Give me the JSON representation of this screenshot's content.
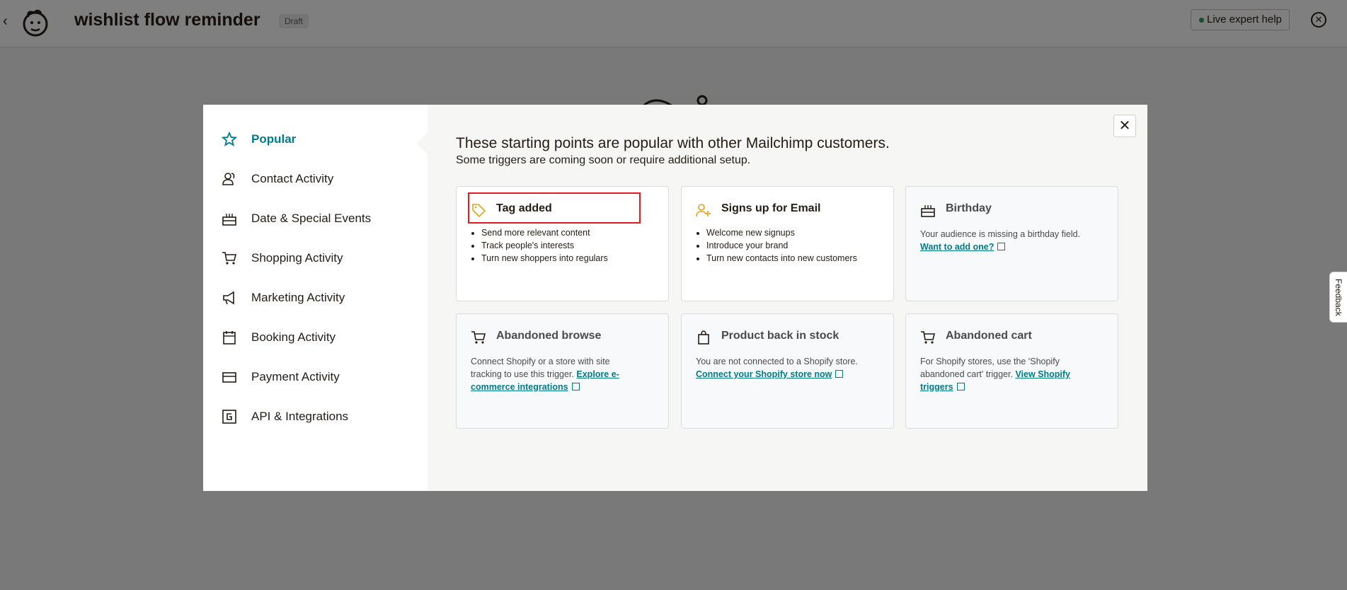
{
  "topbar": {
    "back": "‹",
    "title": "wishlist flow reminder",
    "status_badge": "Draft",
    "expert_help": "Live expert help",
    "close": "✕"
  },
  "feedback_tab": "Feedback",
  "modal": {
    "close": "✕",
    "heading": "These starting points are popular with other Mailchimp customers.",
    "subheading": "Some triggers are coming soon or require additional setup.",
    "sidebar": [
      {
        "label": "Popular",
        "icon": "star-icon",
        "active": true
      },
      {
        "label": "Contact Activity",
        "icon": "contacts-icon"
      },
      {
        "label": "Date & Special Events",
        "icon": "cake-icon"
      },
      {
        "label": "Shopping Activity",
        "icon": "cart-icon"
      },
      {
        "label": "Marketing Activity",
        "icon": "megaphone-icon"
      },
      {
        "label": "Booking Activity",
        "icon": "calendar-icon"
      },
      {
        "label": "Payment Activity",
        "icon": "credit-card-icon"
      },
      {
        "label": "API & Integrations",
        "icon": "api-icon"
      }
    ],
    "cards": [
      {
        "title": "Tag added",
        "icon": "tag-icon",
        "bullets": [
          "Send more relevant content",
          "Track people's interests",
          "Turn new shoppers into regulars"
        ]
      },
      {
        "title": "Signs up for Email",
        "icon": "add-person-icon",
        "bullets": [
          "Welcome new signups",
          "Introduce your brand",
          "Turn new contacts into new customers"
        ]
      },
      {
        "title": "Birthday",
        "icon": "cake-icon",
        "desc": "Your audience is missing a birthday field.",
        "link": "Want to add one?"
      },
      {
        "title": "Abandoned browse",
        "icon": "cart-icon",
        "desc": "Connect Shopify or a store with site tracking to use this trigger.",
        "link": "Explore e-commerce integrations"
      },
      {
        "title": "Product back in stock",
        "icon": "shopping-bag-icon",
        "desc": "You are not connected to a Shopify store.",
        "link": "Connect your Shopify store now"
      },
      {
        "title": "Abandoned cart",
        "icon": "cart-icon",
        "desc": "For Shopify stores, use the 'Shopify abandoned cart' trigger.",
        "link": "View Shopify triggers"
      }
    ]
  },
  "colors": {
    "accent": "#007c89",
    "highlight": "#e31b23",
    "tag_icon": "#e0a31b"
  }
}
